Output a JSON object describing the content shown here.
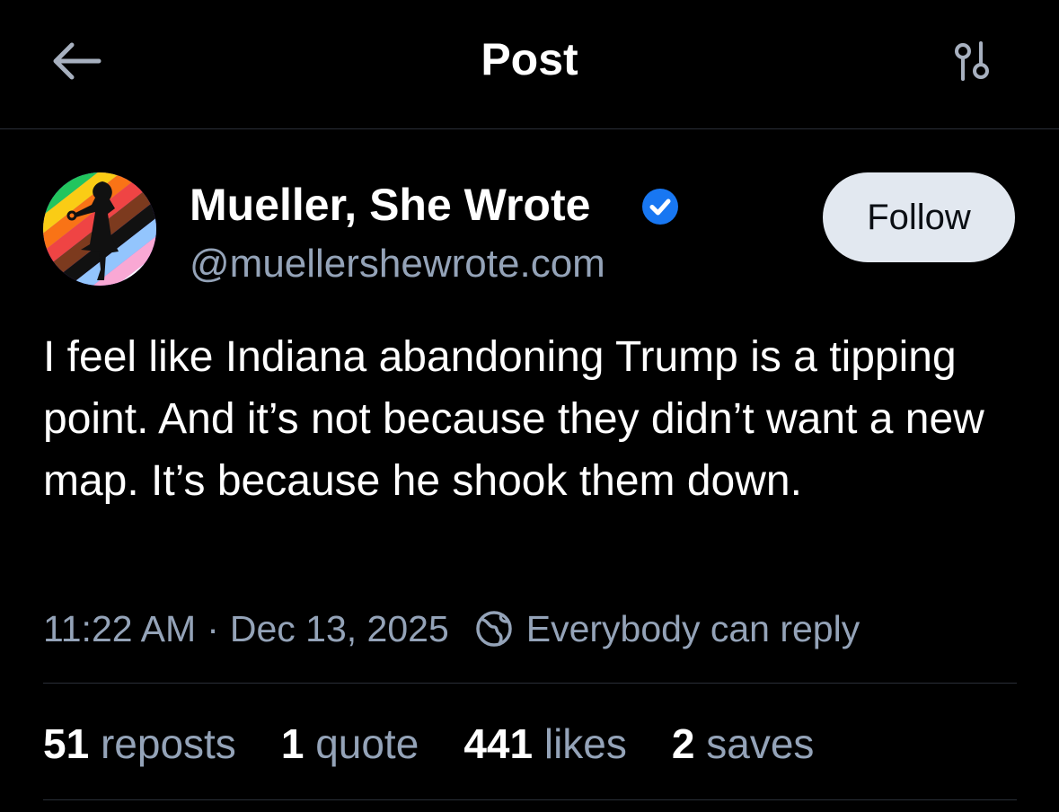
{
  "header": {
    "title": "Post",
    "back_icon": "arrow-left-icon",
    "filter_icon": "sliders-icon"
  },
  "author": {
    "display_name": "Mueller, She Wrote",
    "handle": "@muellershewrote.com",
    "verified": true,
    "follow_label": "Follow"
  },
  "post": {
    "text": "I feel like Indiana abandoning Trump is a tipping point. And it’s not because they didn’t want a new map. It’s because he shook them down.",
    "time": "11:22 AM",
    "separator": "·",
    "date": "Dec 13, 2025",
    "reply_setting": "Everybody can reply"
  },
  "stats": {
    "reposts_count": "51",
    "reposts_label": "reposts",
    "quotes_count": "1",
    "quotes_label": "quote",
    "likes_count": "441",
    "likes_label": "likes",
    "saves_count": "2",
    "saves_label": "saves"
  },
  "colors": {
    "background": "#000000",
    "muted_text": "#94a3b8",
    "follow_button_bg": "#e2e8f0",
    "verified_blue": "#1877f2",
    "divider": "#2a2f38"
  }
}
